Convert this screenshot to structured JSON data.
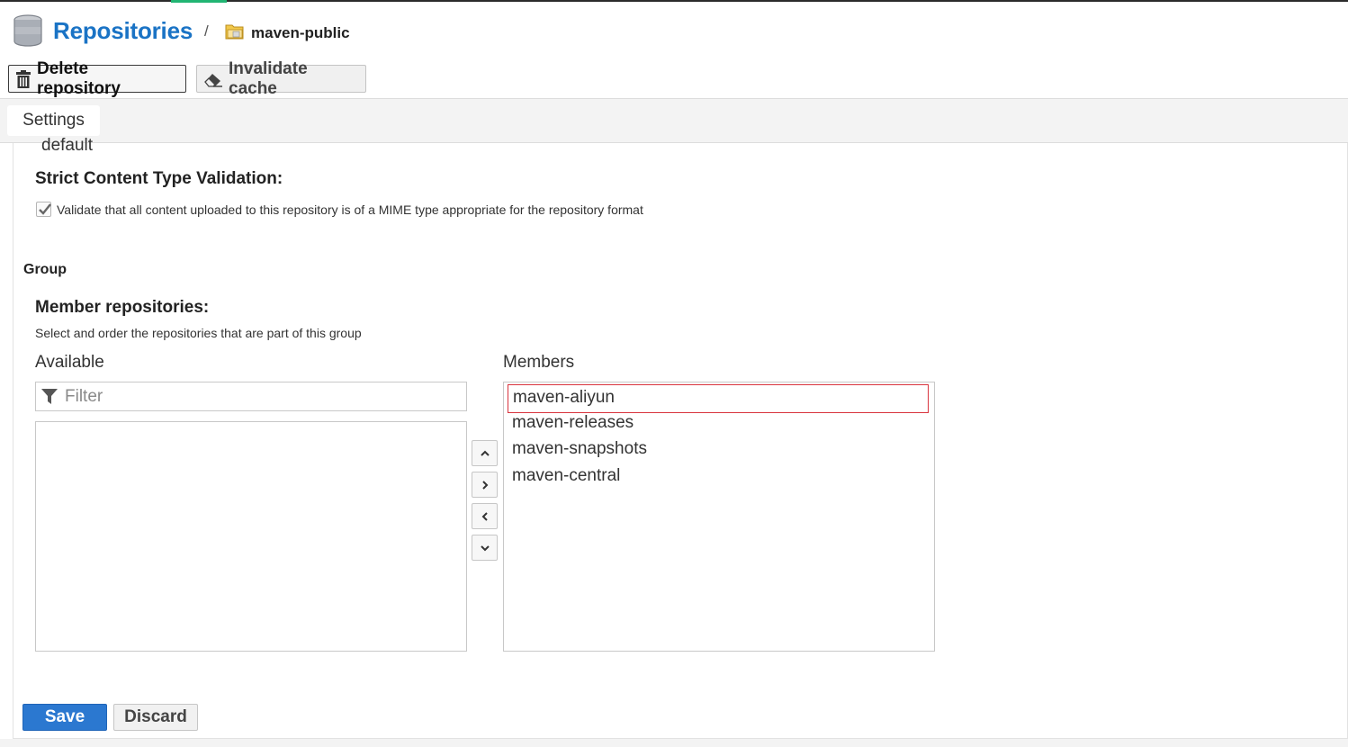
{
  "header": {
    "breadcrumb_root": "Repositories",
    "separator": "/",
    "current_repo": "maven-public",
    "delete_label": "Delete repository",
    "invalidate_label": "Invalidate cache"
  },
  "tabs": {
    "settings": "Settings"
  },
  "form": {
    "cutoff_text": "default",
    "strict_label": "Strict Content Type Validation:",
    "strict_checkbox_label": "Validate that all content uploaded to this repository is of a MIME type appropriate for the repository format",
    "strict_checked": true,
    "group_section": "Group",
    "member_repos_label": "Member repositories:",
    "member_repos_help": "Select and order the repositories that are part of this group",
    "available_title": "Available",
    "members_title": "Members",
    "filter_placeholder": "Filter",
    "members": [
      "maven-aliyun",
      "maven-releases",
      "maven-snapshots",
      "maven-central"
    ],
    "selected_member": "maven-aliyun"
  },
  "icons": {
    "database": "database-icon",
    "folder": "folder-icon",
    "trash": "trash-icon",
    "eraser": "eraser-icon",
    "filter": "filter-icon",
    "move_up": "chevron-up-icon",
    "move_right": "chevron-right-icon",
    "move_left": "chevron-left-icon",
    "move_down": "chevron-down-icon"
  },
  "footer": {
    "save_label": "Save",
    "discard_label": "Discard"
  },
  "colors": {
    "brand_blue": "#1a73c5",
    "save_button": "#2b78d0",
    "selection_border": "#d9343e",
    "accent_green": "#21b573"
  }
}
